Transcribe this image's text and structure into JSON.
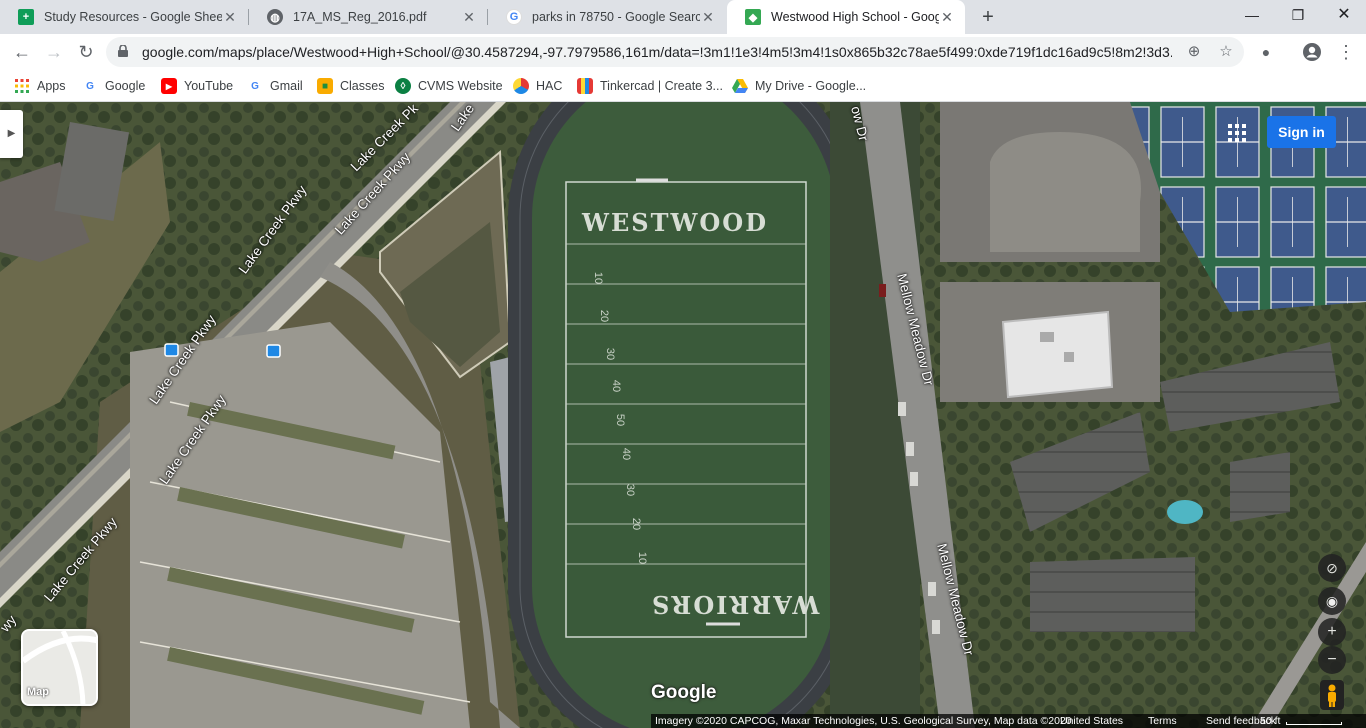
{
  "tabs": [
    {
      "label": "Study Resources - Google Sheets",
      "icon": "sheets-icon",
      "color": "#0f9d58"
    },
    {
      "label": "17A_MS_Reg_2016.pdf",
      "icon": "globe-icon",
      "color": "#5f6368"
    },
    {
      "label": "parks in 78750 - Google Search",
      "icon": "google-icon",
      "color": "#4285f4"
    },
    {
      "label": "Westwood High School - Google",
      "icon": "maps-icon",
      "color": "#34a853"
    }
  ],
  "toolbar": {
    "url": "google.com/maps/place/Westwood+High+School/@30.4587294,-97.7979586,161m/data=!3m1!1e3!4m5!3m4!1s0x865b32c78ae5f499:0xde719f1dc16ad9c5!8m2!3d3..."
  },
  "bookmarks": [
    {
      "label": "Apps",
      "icon": "apps-icon"
    },
    {
      "label": "Google",
      "icon": "google-icon"
    },
    {
      "label": "YouTube",
      "icon": "youtube-icon"
    },
    {
      "label": "Gmail",
      "icon": "google-icon"
    },
    {
      "label": "Classes",
      "icon": "classroom-icon"
    },
    {
      "label": "CVMS Website",
      "icon": "cvms-icon"
    },
    {
      "label": "HAC",
      "icon": "hac-icon"
    },
    {
      "label": "Tinkercad | Create 3...",
      "icon": "tinkercad-icon"
    },
    {
      "label": "My Drive - Google...",
      "icon": "drive-icon"
    }
  ],
  "map": {
    "street_labels": {
      "lake_creek_1": "Lake Creek Pkwy",
      "lake_creek_2": "Lake Creek Pkwy",
      "lake_creek_3": "Lake Creek Pkwy",
      "lake_creek_4": "Lake Creek Pkwy",
      "lake_creek_5": "Lake Creek Pkwy",
      "lake_creek_6": "Lake Creek Pkwy",
      "lake_top_1": "Lake Creek Pk",
      "lake_top_2": "Lake",
      "pkwy_edge": "wy",
      "mellow_1": "Mellow Meadow Dr",
      "mellow_2": "Mellow Meadow Dr",
      "mellow_top": "ow Dr"
    },
    "field_text": {
      "endzone_top": "WESTWOOD",
      "endzone_bottom": "WARRIORS"
    },
    "yard_numbers": [
      "10",
      "20",
      "30",
      "40",
      "50",
      "40",
      "30",
      "20",
      "10"
    ],
    "sign_in_label": "Sign in",
    "minimap_label": "Map",
    "google_logo": "Google",
    "attribution": {
      "imagery": "Imagery ©2020 CAPCOG, Maxar Technologies, U.S. Geological Survey, Map data ©2020",
      "country": "United States",
      "terms": "Terms",
      "feedback": "Send feedback",
      "scale": "50 ft"
    }
  }
}
